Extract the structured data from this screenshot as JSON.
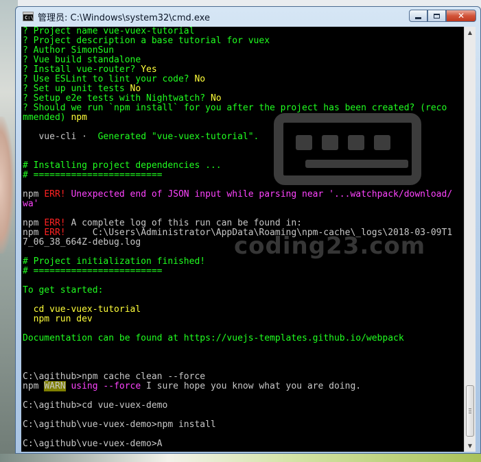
{
  "window": {
    "title": "管理员: C:\\Windows\\system32\\cmd.exe",
    "icon": "cmd-icon",
    "buttons": [
      "minimize",
      "maximize",
      "close"
    ]
  },
  "console": {
    "lines": [
      [
        {
          "t": "? Project name ",
          "c": "green"
        },
        {
          "t": "vue-vuex-tutorial",
          "c": "green"
        }
      ],
      [
        {
          "t": "? Project description ",
          "c": "green"
        },
        {
          "t": "a base tutorial for vuex",
          "c": "green"
        }
      ],
      [
        {
          "t": "? Author ",
          "c": "green"
        },
        {
          "t": "SimonSun",
          "c": "green"
        }
      ],
      [
        {
          "t": "? Vue build ",
          "c": "green"
        },
        {
          "t": "standalone",
          "c": "green"
        }
      ],
      [
        {
          "t": "? Install vue-router? ",
          "c": "green"
        },
        {
          "t": "Yes",
          "c": "yellow"
        }
      ],
      [
        {
          "t": "? Use ESLint to lint your code? ",
          "c": "green"
        },
        {
          "t": "No",
          "c": "yellow"
        }
      ],
      [
        {
          "t": "? Set up unit tests ",
          "c": "green"
        },
        {
          "t": "No",
          "c": "yellow"
        }
      ],
      [
        {
          "t": "? Setup e2e tests with Nightwatch? ",
          "c": "green"
        },
        {
          "t": "No",
          "c": "yellow"
        }
      ],
      [
        {
          "t": "? Should we run `npm install` for you after the project has been created? (reco",
          "c": "green"
        }
      ],
      [
        {
          "t": "mmended) ",
          "c": "green"
        },
        {
          "t": "npm",
          "c": "yellow"
        }
      ],
      [],
      [
        {
          "t": "   vue-cli · ",
          "c": "gray"
        },
        {
          "t": " Generated \"vue-vuex-tutorial\".",
          "c": "green"
        }
      ],
      [],
      [],
      [
        {
          "t": "# Installing project dependencies ...",
          "c": "green"
        }
      ],
      [
        {
          "t": "# ========================",
          "c": "green"
        }
      ],
      [],
      [
        {
          "t": "npm ",
          "c": "gray"
        },
        {
          "t": "ERR!",
          "c": "red"
        },
        {
          "t": " Unexpected end of JSON input while parsing near '...watchpack/download/",
          "c": "magenta"
        }
      ],
      [
        {
          "t": "wa'",
          "c": "magenta"
        }
      ],
      [],
      [
        {
          "t": "npm ",
          "c": "gray"
        },
        {
          "t": "ERR!",
          "c": "red"
        },
        {
          "t": " A complete log of this run can be found in:",
          "c": "gray"
        }
      ],
      [
        {
          "t": "npm ",
          "c": "gray"
        },
        {
          "t": "ERR!",
          "c": "red"
        },
        {
          "t": "     C:\\Users\\Administrator\\AppData\\Roaming\\npm-cache\\_logs\\2018-03-09T1",
          "c": "gray"
        }
      ],
      [
        {
          "t": "7_06_38_664Z-debug.log",
          "c": "gray"
        }
      ],
      [],
      [
        {
          "t": "# Project initialization finished!",
          "c": "green"
        }
      ],
      [
        {
          "t": "# ========================",
          "c": "green"
        }
      ],
      [],
      [
        {
          "t": "To get started:",
          "c": "green"
        }
      ],
      [],
      [
        {
          "t": "  cd vue-vuex-tutorial",
          "c": "yellow"
        }
      ],
      [
        {
          "t": "  npm run dev",
          "c": "yellow"
        }
      ],
      [],
      [
        {
          "t": "Documentation can be found at https://vuejs-templates.github.io/webpack",
          "c": "green"
        }
      ],
      [],
      [],
      [],
      [
        {
          "t": "C:\\agithub>npm cache clean --force",
          "c": "gray"
        }
      ],
      [
        {
          "t": "npm ",
          "c": "gray"
        },
        {
          "t": "WARN",
          "c": "warnbg"
        },
        {
          "t": " using --force",
          "c": "magenta"
        },
        {
          "t": " I sure hope you know what you are doing.",
          "c": "gray"
        }
      ],
      [],
      [
        {
          "t": "C:\\agithub>cd vue-vuex-demo",
          "c": "gray"
        }
      ],
      [],
      [
        {
          "t": "C:\\agithub\\vue-vuex-demo>npm install",
          "c": "gray"
        }
      ],
      [],
      [
        {
          "t": "C:\\agithub\\vue-vuex-demo>A",
          "c": "gray"
        }
      ]
    ]
  },
  "watermark": {
    "text": "coding23.com",
    "icon": "keyboard-icon"
  },
  "colors": {
    "green": "#20ff20",
    "yellow": "#ffff3a",
    "red": "#ff2222",
    "gray": "#c8c8c8",
    "magenta": "#ff44ff",
    "warn_bg": "#808000"
  }
}
